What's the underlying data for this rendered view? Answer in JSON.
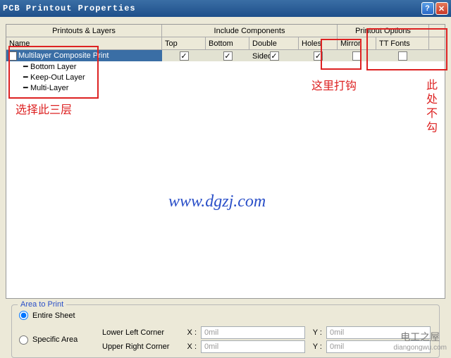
{
  "window": {
    "title": "PCB Printout Properties"
  },
  "grid": {
    "header1": {
      "printouts": "Printouts & Layers",
      "comps": "Include Components",
      "opts": "Printout Options"
    },
    "header2": {
      "name": "Name",
      "top": "Top",
      "bottom": "Bottom",
      "double": "Double Sided",
      "holes": "Holes",
      "mirror": "Mirror",
      "ttfonts": "TT Fonts"
    },
    "row": {
      "name": "Multilayer Composite Print",
      "top": true,
      "bottom": true,
      "double": true,
      "holes": true,
      "mirror": false,
      "ttfonts": false
    },
    "tree": [
      "Bottom Layer",
      "Keep-Out Layer",
      "Multi-Layer"
    ]
  },
  "annotations": {
    "tree": "选择此三层",
    "holes": "这里打钩",
    "opts": "此处不勾"
  },
  "watermark": {
    "url": "www.dgzj.com",
    "site_cn": "电工之屋",
    "site_py": "diangongwu.com"
  },
  "areaToPrint": {
    "legend": "Area to Print",
    "entire": "Entire Sheet",
    "specific": "Specific Area",
    "llc": "Lower Left Corner",
    "urc": "Upper Right Corner",
    "x": "X :",
    "y": "Y :",
    "val": "0mil"
  }
}
